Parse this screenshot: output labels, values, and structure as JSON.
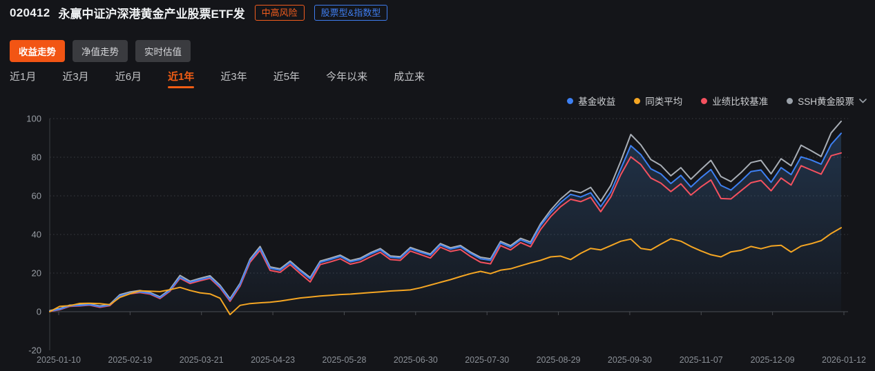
{
  "header": {
    "fund_code": "020412",
    "fund_name": "永赢中证沪深港黄金产业股票ETF发",
    "risk_badge": "中高风险",
    "type_badge": "股票型&指数型"
  },
  "view_tabs": [
    {
      "label": "收益走势",
      "active": true
    },
    {
      "label": "净值走势",
      "active": false
    },
    {
      "label": "实时估值",
      "active": false
    }
  ],
  "range_tabs": [
    {
      "label": "近1月",
      "active": false
    },
    {
      "label": "近3月",
      "active": false
    },
    {
      "label": "近6月",
      "active": false
    },
    {
      "label": "近1年",
      "active": true
    },
    {
      "label": "近3年",
      "active": false
    },
    {
      "label": "近5年",
      "active": false
    },
    {
      "label": "今年以来",
      "active": false
    },
    {
      "label": "成立来",
      "active": false
    }
  ],
  "legend": [
    {
      "label": "基金收益",
      "color": "#3d80f3",
      "has_chevron": false
    },
    {
      "label": "同类平均",
      "color": "#f5a623",
      "has_chevron": false
    },
    {
      "label": "业绩比较基准",
      "color": "#f5515f",
      "has_chevron": false
    },
    {
      "label": "SSH黄金股票",
      "color": "#9aa1a9",
      "has_chevron": true
    }
  ],
  "colors": {
    "accent_orange": "#f25514",
    "badge_orange": "#f25d1e",
    "badge_blue": "#3f7ef0",
    "background": "#141519",
    "grid_line": "#3a3d42",
    "axis_line": "#4a4d52",
    "axis_text": "#999ea5",
    "date_text": "#8b9097",
    "area_fill_rgb": "70,135,210"
  },
  "chart_data": {
    "type": "line",
    "title": "",
    "xlabel": "",
    "ylabel": "",
    "ylim": [
      -20,
      100
    ],
    "y_ticks": [
      100,
      80,
      60,
      40,
      20,
      0,
      -20
    ],
    "grid": "horizontal-dotted",
    "legend_position": "top-right",
    "x_tick_labels": [
      "2025-01-10",
      "2025-02-19",
      "2025-03-21",
      "2025-04-23",
      "2025-05-28",
      "2025-06-30",
      "2025-07-30",
      "2025-08-29",
      "2025-09-30",
      "2025-11-07",
      "2025-12-09",
      "2026-01-12"
    ],
    "x_range_note": "80 evenly spaced samples from 2025-01-10 to 2026-01-12, values in percent return",
    "series": [
      {
        "name": "基金收益",
        "color": "#3d80f3",
        "area_fill": true,
        "values": [
          0.3,
          1.2,
          3.0,
          3.2,
          3.6,
          2.6,
          3.4,
          8.3,
          9.6,
          10.2,
          9.5,
          7.2,
          11.0,
          17.8,
          15.2,
          16.6,
          17.8,
          13.0,
          6.0,
          14.0,
          26.5,
          32.8,
          22.5,
          21.5,
          25.5,
          21.0,
          17.0,
          25.5,
          27.0,
          28.6,
          25.8,
          27.0,
          29.8,
          32.0,
          28.2,
          27.8,
          32.6,
          30.8,
          29.2,
          34.6,
          32.4,
          33.6,
          30.2,
          27.4,
          26.6,
          35.6,
          33.4,
          37.2,
          35.2,
          44.6,
          51.2,
          56.6,
          60.8,
          59.4,
          61.6,
          54.4,
          62.0,
          74.0,
          86.0,
          81.4,
          74.0,
          71.4,
          66.4,
          70.6,
          64.6,
          69.4,
          73.6,
          65.4,
          63.0,
          67.6,
          72.6,
          73.4,
          67.0,
          74.6,
          71.0,
          80.2,
          78.6,
          76.4,
          86.6,
          92.4
        ]
      },
      {
        "name": "同类平均",
        "color": "#f5a623",
        "area_fill": false,
        "values": [
          0.0,
          2.8,
          3.1,
          4.3,
          4.4,
          4.2,
          3.6,
          7.4,
          9.3,
          10.8,
          10.6,
          10.4,
          11.4,
          12.6,
          11.0,
          9.8,
          9.2,
          7.0,
          -1.5,
          3.3,
          4.2,
          4.6,
          4.9,
          5.5,
          6.3,
          7.1,
          7.6,
          8.1,
          8.5,
          8.9,
          9.1,
          9.5,
          9.9,
          10.3,
          10.7,
          11.0,
          11.3,
          12.4,
          13.8,
          15.2,
          16.6,
          18.2,
          19.7,
          20.9,
          19.7,
          21.5,
          22.2,
          23.8,
          25.3,
          26.6,
          28.4,
          28.8,
          27.0,
          30.2,
          32.8,
          32.0,
          34.2,
          36.5,
          37.6,
          32.8,
          32.0,
          35.0,
          37.8,
          36.5,
          33.8,
          31.5,
          29.5,
          28.4,
          31.0,
          31.8,
          33.8,
          32.6,
          34.0,
          34.4,
          30.9,
          34.0,
          35.2,
          36.8,
          40.5,
          43.5
        ]
      },
      {
        "name": "业绩比较基准",
        "color": "#f5515f",
        "area_fill": false,
        "values": [
          0.1,
          1.0,
          2.8,
          3.0,
          3.4,
          2.3,
          3.1,
          8.0,
          9.3,
          9.9,
          9.1,
          6.8,
          10.6,
          17.3,
          14.6,
          16.0,
          17.3,
          12.4,
          5.4,
          13.2,
          25.6,
          31.8,
          21.4,
          20.4,
          24.4,
          19.8,
          15.4,
          24.4,
          25.8,
          27.4,
          24.6,
          25.8,
          28.4,
          30.8,
          27.0,
          26.6,
          31.4,
          29.6,
          27.8,
          33.4,
          31.2,
          32.2,
          28.6,
          25.6,
          24.8,
          34.2,
          32.0,
          35.8,
          33.6,
          42.6,
          49.2,
          54.4,
          58.2,
          57.0,
          59.2,
          51.8,
          59.4,
          71.0,
          80.2,
          76.2,
          69.2,
          66.6,
          62.2,
          66.2,
          60.4,
          64.6,
          68.2,
          58.6,
          58.4,
          62.6,
          66.8,
          68.0,
          62.6,
          69.2,
          65.6,
          75.6,
          73.4,
          71.2,
          80.8,
          82.2
        ]
      },
      {
        "name": "SSH黄金股票",
        "color": "#a8aeb6",
        "area_fill": false,
        "values": [
          0.6,
          1.6,
          3.4,
          3.6,
          4.0,
          3.0,
          3.8,
          8.8,
          10.2,
          11.0,
          10.0,
          7.7,
          11.6,
          18.8,
          15.8,
          17.3,
          18.6,
          13.7,
          6.8,
          14.7,
          27.3,
          33.8,
          23.2,
          22.2,
          26.2,
          21.7,
          17.7,
          26.2,
          27.7,
          29.3,
          26.5,
          27.7,
          30.5,
          32.7,
          28.9,
          28.5,
          33.3,
          31.5,
          29.9,
          35.3,
          33.1,
          34.3,
          30.9,
          28.2,
          27.4,
          36.4,
          34.2,
          38.0,
          36.1,
          45.6,
          52.6,
          58.4,
          62.8,
          61.6,
          64.4,
          57.2,
          65.4,
          78.0,
          91.8,
          86.4,
          78.8,
          75.8,
          70.4,
          74.6,
          68.6,
          73.6,
          78.4,
          70.0,
          67.4,
          72.0,
          77.2,
          78.4,
          71.4,
          79.2,
          75.6,
          86.2,
          83.4,
          80.4,
          92.6,
          98.6
        ]
      }
    ]
  }
}
